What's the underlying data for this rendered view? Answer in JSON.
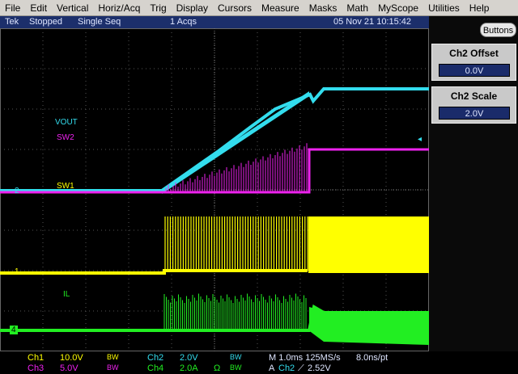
{
  "menubar": {
    "items": [
      "File",
      "Edit",
      "Vertical",
      "Horiz/Acq",
      "Trig",
      "Display",
      "Cursors",
      "Measure",
      "Masks",
      "Math",
      "MyScope",
      "Utilities",
      "Help"
    ]
  },
  "status": {
    "brand": "Tek",
    "state": "Stopped",
    "mode": "Single Seq",
    "acqs": "1 Acqs",
    "datetime": "05 Nov 21 10:15:42"
  },
  "panel": {
    "buttons_label": "Buttons",
    "offset": {
      "title": "Ch2 Offset",
      "value": "0.0V"
    },
    "scale": {
      "title": "Ch2 Scale",
      "value": "2.0V"
    }
  },
  "traces": {
    "vout": "VOUT",
    "sw2": "SW2",
    "sw1": "SW1",
    "il": "IL"
  },
  "ground_markers": {
    "ch2": "2",
    "ch1": "1",
    "ch4": "4"
  },
  "readout": {
    "ch1": {
      "name": "Ch1",
      "scale": "10.0V",
      "bw": "BW"
    },
    "ch3": {
      "name": "Ch3",
      "scale": "5.0V",
      "bw": "BW"
    },
    "ch2": {
      "name": "Ch2",
      "scale": "2.0V",
      "bw": "BW"
    },
    "ch4": {
      "name": "Ch4",
      "scale": "2.0A",
      "ohm": "Ω",
      "bw": "BW"
    },
    "timebase": "M 1.0ms 125MS/s",
    "record": "8.0ns/pt",
    "trigger_prefix": "A",
    "trigger_source": "Ch2",
    "trigger_slope": "⟋",
    "trigger_level": "2.52V"
  },
  "colors": {
    "ch1": "#ffff00",
    "ch2": "#33ddee",
    "ch3": "#ee22ee",
    "ch4": "#22ee22",
    "status_bg": "#1c2f6b",
    "menu_bg": "#d6d3ce"
  }
}
